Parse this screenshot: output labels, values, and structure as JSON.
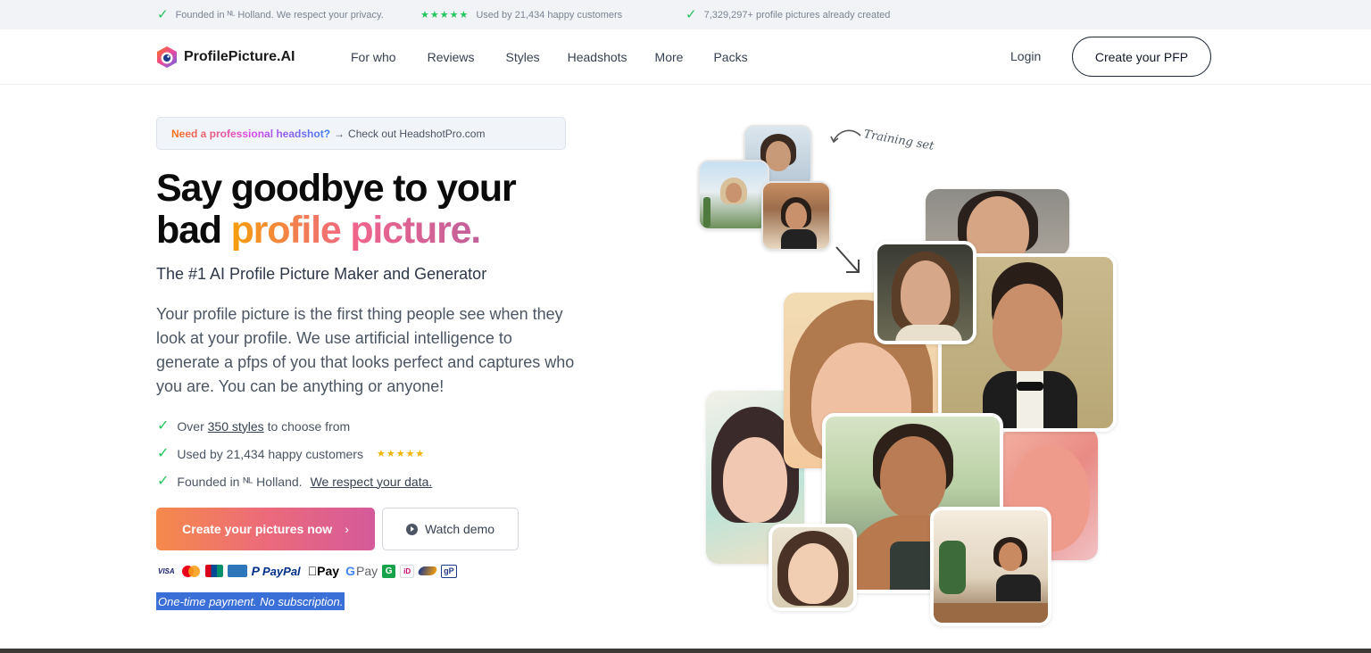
{
  "topbar": {
    "item1": "Founded in ᴺᴸ Holland. We respect your privacy.",
    "item2_stars": "★★★★★",
    "item2": "Used by 21,434 happy customers",
    "item3": "7,329,297+ profile pictures already created"
  },
  "nav": {
    "logo_text": "ProfilePicture.AI",
    "links": [
      "For who",
      "Reviews",
      "Styles",
      "Headshots",
      "More",
      "Packs"
    ],
    "login": "Login",
    "cta": "Create your PFP"
  },
  "promo": {
    "strong": "Need a professional headshot?",
    "arrow": "→",
    "rest": "Check out HeadshotPro.com"
  },
  "hero": {
    "headline_line1": "Say goodbye to your",
    "headline_bad": "bad",
    "headline_highlight": "profile picture.",
    "subhead": "The #1 AI Profile Picture Maker and Generator",
    "description": "Your profile picture is the first thing people see when they look at your profile. We use artificial intelligence to generate a pfps of you that looks perfect and captures who you are. You can be anything or anyone!"
  },
  "features": {
    "f1_pre": "Over",
    "f1_link": "350 styles",
    "f1_post": "to choose from",
    "f2": "Used by 21,434 happy customers",
    "f2_stars": "★★★★★",
    "f3_pre": "Founded in ᴺᴸ Holland.",
    "f3_link": "We respect your data."
  },
  "buttons": {
    "primary": "Create your pictures now",
    "primary_chevron": "›",
    "demo": "Watch demo"
  },
  "payments": {
    "visa": "VISA",
    "paypal_p": "P",
    "paypal": "PayPal",
    "applepay": "Pay",
    "gpay_g": "G",
    "gpay": "Pay",
    "g_green": "G",
    "ideal": "iD",
    "gp": "gP"
  },
  "note": "One-time payment. No subscription.",
  "collage": {
    "training_label": "Training set"
  },
  "colors": {
    "accent_check": "#22c55e",
    "primary_gradient_start": "#f58a4b",
    "primary_gradient_end": "#d45a9a",
    "star": "#f5b301",
    "selection_highlight": "#3b6fd8"
  }
}
